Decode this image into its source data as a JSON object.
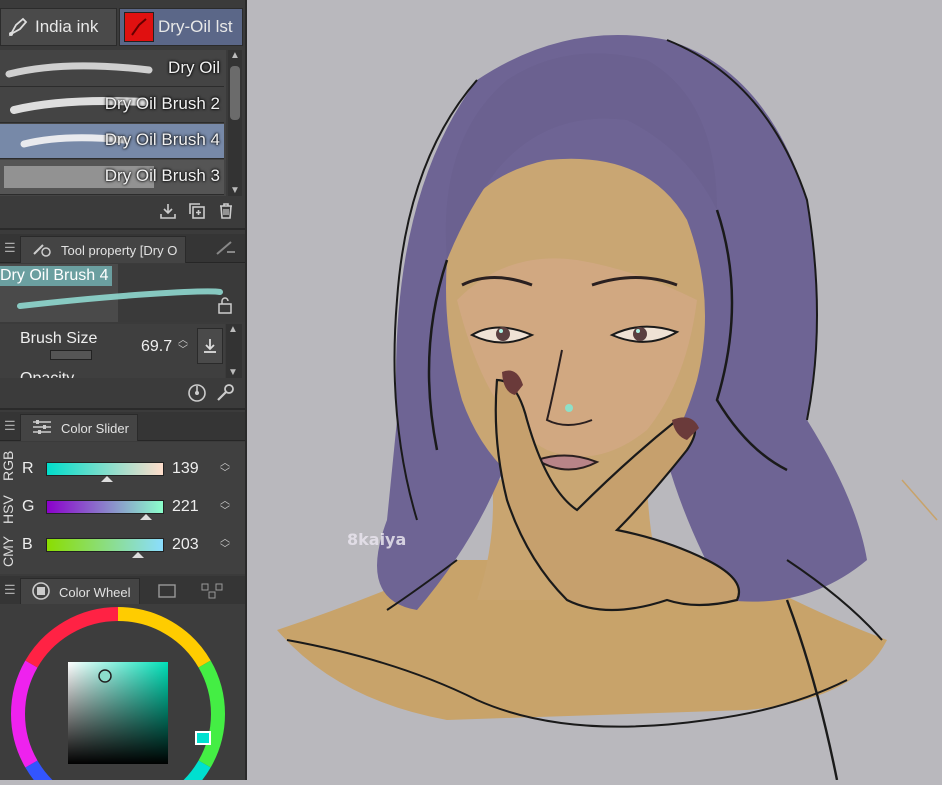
{
  "subtool_tabs": [
    {
      "label": "India ink",
      "icon": "pen-nib-icon"
    },
    {
      "label": "Dry-Oil lst",
      "icon": "red-brush-icon"
    }
  ],
  "brushes": [
    {
      "name": "Dry Oil"
    },
    {
      "name": "Dry Oil Brush 2"
    },
    {
      "name": "Dry Oil Brush 4",
      "selected": true
    },
    {
      "name": "Dry Oil Brush 3"
    }
  ],
  "tool_property": {
    "header": "Tool property [Dry O",
    "brush_name": "Dry Oil Brush 4",
    "brush_size_label": "Brush Size",
    "brush_size_value": "69.7",
    "next_row_partial": "Opacity"
  },
  "color_slider": {
    "header": "Color Slider",
    "modes": [
      "RGB",
      "HSV",
      "CMY"
    ],
    "channels": [
      {
        "label": "R",
        "value": "139",
        "fraction": 0.545
      },
      {
        "label": "G",
        "value": "221",
        "fraction": 0.867
      },
      {
        "label": "B",
        "value": "203",
        "fraction": 0.796
      }
    ]
  },
  "color_wheel": {
    "header": "Color Wheel",
    "current_color": "#8bddcb"
  },
  "canvas": {
    "watermark": "8kaiya",
    "background": "#b9b8bd"
  }
}
